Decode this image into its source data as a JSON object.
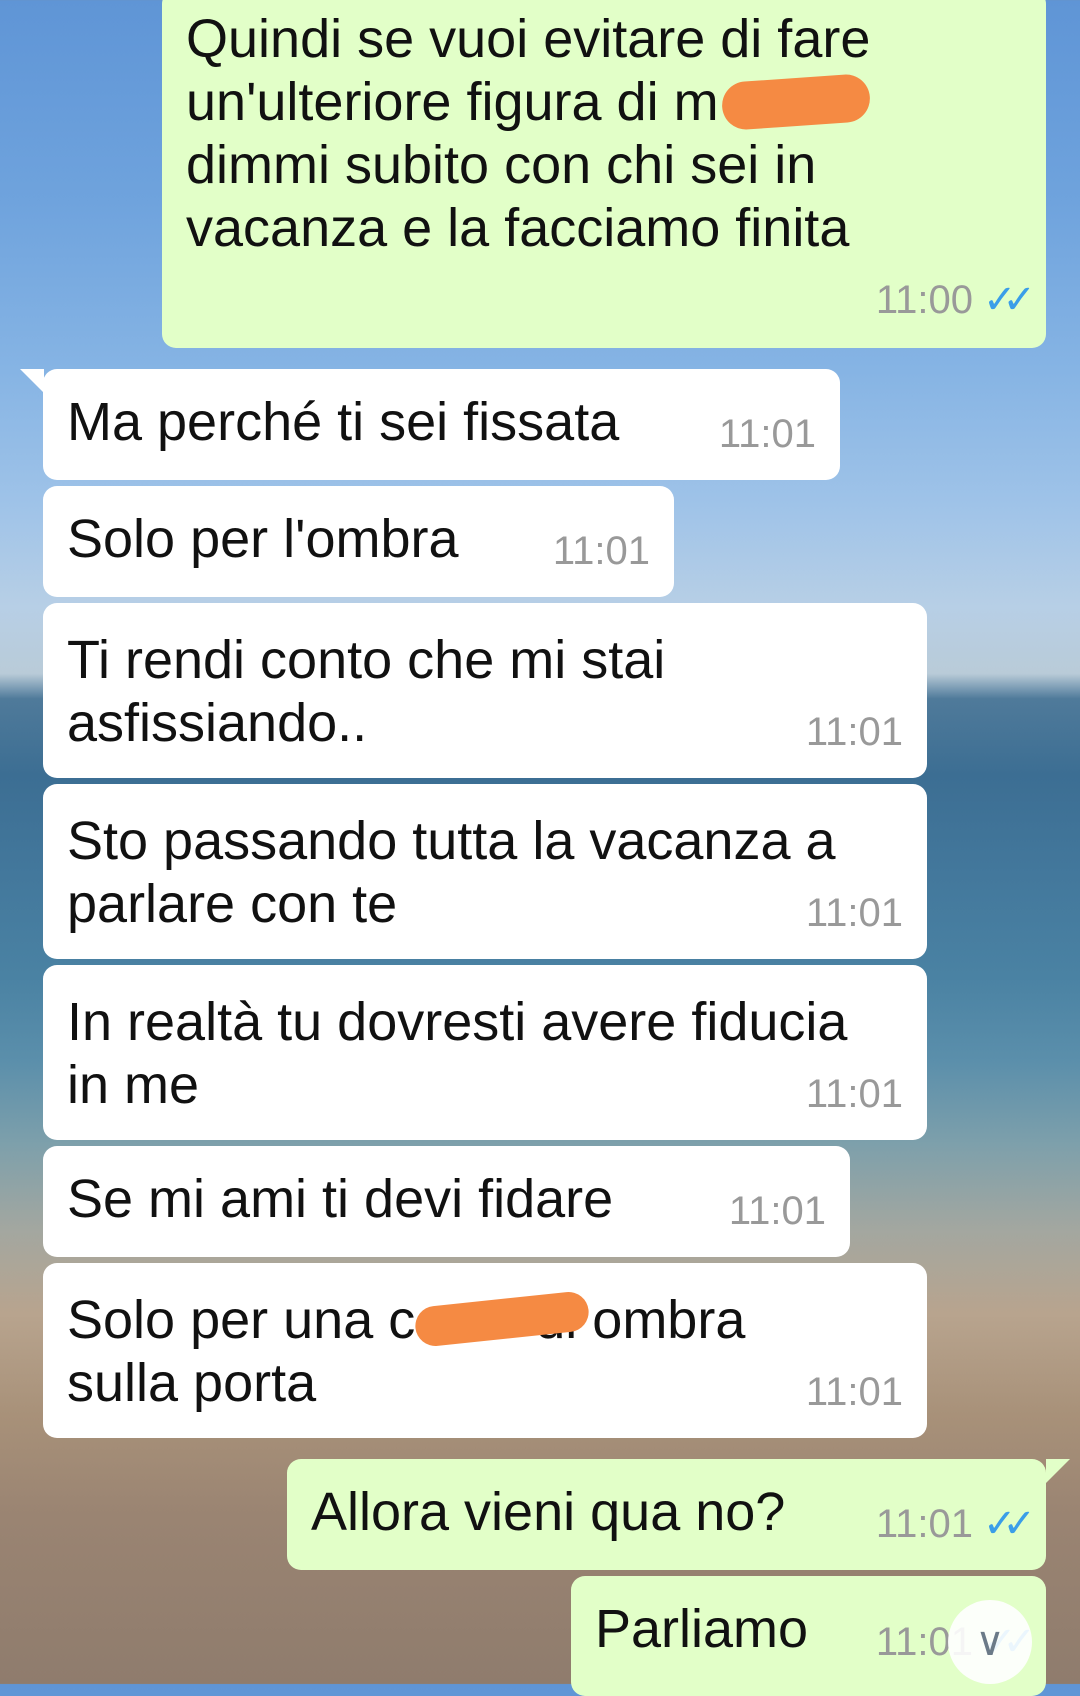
{
  "messages": [
    {
      "text": "Quindi se vuoi evitare di fare\nun'ulteriore figura di m\ndimmi subito con chi sei in\nvacanza e la facciamo finita",
      "time": "11:00",
      "status": "read"
    },
    {
      "text": "Ma perché ti sei fissata",
      "time": "11:01"
    },
    {
      "text": "Solo per l'ombra",
      "time": "11:01"
    },
    {
      "text": "Ti rendi conto che mi stai\nasfissiando..",
      "time": "11:01"
    },
    {
      "text": "Sto passando tutta la vacanza a\nparlare con te",
      "time": "11:01"
    },
    {
      "text": "In realtà tu dovresti avere fiducia\nin me",
      "time": "11:01"
    },
    {
      "text": "Se mi ami ti devi fidare",
      "time": "11:01"
    },
    {
      "text": "Solo per una c        di ombra\nsulla porta",
      "time": "11:01"
    },
    {
      "text": "Allora vieni qua no?",
      "time": "11:01",
      "status": "read"
    },
    {
      "text": "Parliamo",
      "time": "11:01",
      "status": "read"
    }
  ],
  "icons": {
    "read_receipt": "double-check-icon",
    "scroll_down": "chevron-down-icon"
  },
  "colors": {
    "outgoing_bubble": "#e2ffc8",
    "incoming_bubble": "#ffffff",
    "read_ticks": "#3a9ee8",
    "redaction": "#f58a43"
  }
}
